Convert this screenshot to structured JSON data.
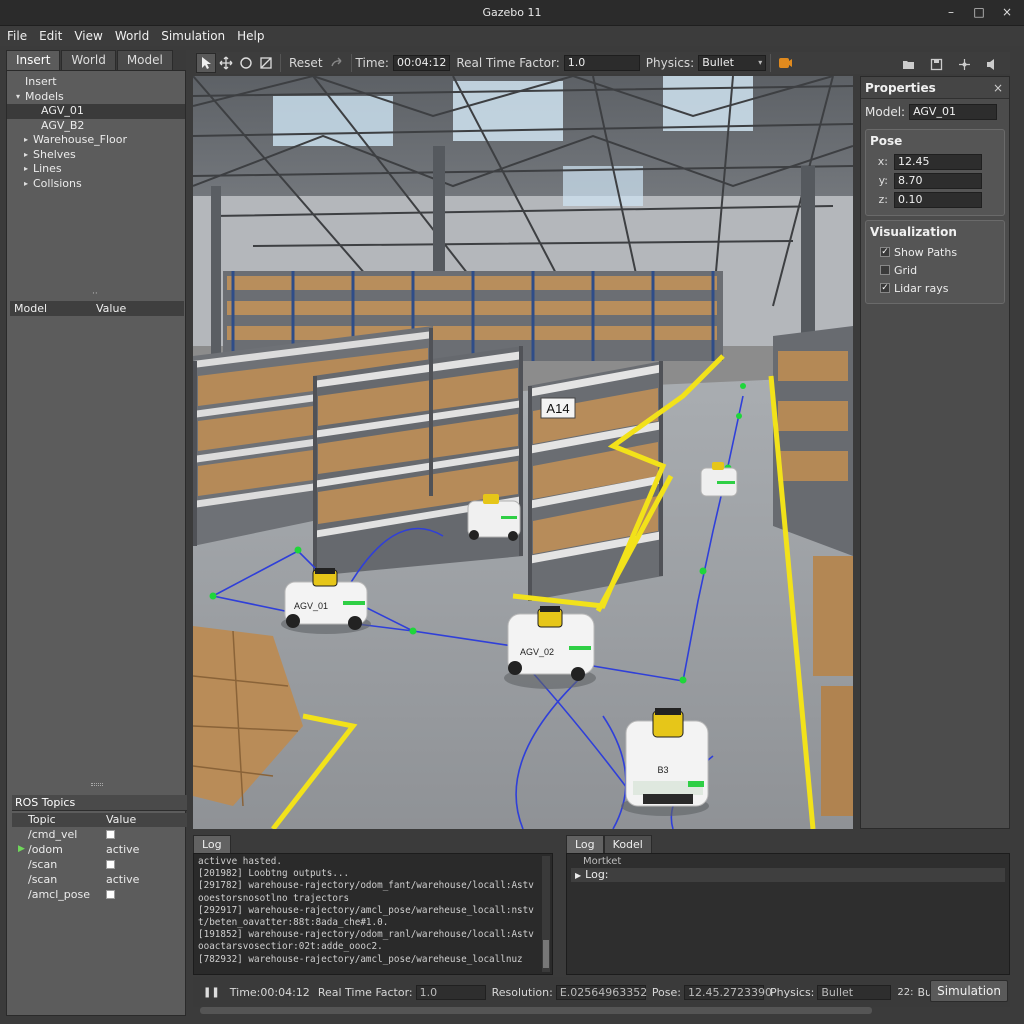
{
  "window": {
    "title": "Gazebo 11",
    "controls": [
      "–",
      "□",
      "×"
    ]
  },
  "menubar": [
    "File",
    "Edit",
    "View",
    "World",
    "Simulation",
    "Help"
  ],
  "left_panel": {
    "tabs": [
      "Insert",
      "World",
      "Model"
    ],
    "tree": [
      {
        "label": "Insert",
        "indent": 0,
        "arrow": ""
      },
      {
        "label": "Models",
        "indent": 0,
        "arrow": "▾"
      },
      {
        "label": "AGV_01",
        "indent": 2,
        "arrow": "",
        "selected": true
      },
      {
        "label": "AGV_B2",
        "indent": 2,
        "arrow": ""
      },
      {
        "label": "Warehouse_Floor",
        "indent": 1,
        "arrow": "▸"
      },
      {
        "label": "Shelves",
        "indent": 1,
        "arrow": "▸"
      },
      {
        "label": "Lines",
        "indent": 1,
        "arrow": "▸"
      },
      {
        "label": "Collsions",
        "indent": 1,
        "arrow": "▸"
      }
    ],
    "property_columns": [
      "Model",
      "Value"
    ],
    "ros_topics": {
      "title": "ROS Topics",
      "columns": [
        "Topic",
        "Value"
      ],
      "rows": [
        {
          "topic": "/cmd_vel",
          "value": "",
          "checkbox": true,
          "marked": false
        },
        {
          "topic": "/odom",
          "value": "active",
          "checkbox": false,
          "marked": true
        },
        {
          "topic": "/scan",
          "value": "",
          "checkbox": true,
          "marked": false
        },
        {
          "topic": "/scan",
          "value": "active",
          "checkbox": false,
          "marked": false
        },
        {
          "topic": "/amcl_pose",
          "value": "",
          "checkbox": true,
          "marked": false
        }
      ]
    }
  },
  "toolbar": {
    "reset_label": "Reset",
    "time_label": "Time:",
    "time_value": "00:04:12",
    "rtf_label": "Real Time Factor:",
    "rtf_value": "1.0",
    "physics_label": "Physics:",
    "physics_value": "Bullet"
  },
  "scene": {
    "shelf_label": "A14",
    "agv_labels": [
      "AGV_01",
      "AGV_02",
      "B3"
    ]
  },
  "properties": {
    "title": "Properties",
    "model_label": "Model:",
    "model_value": "AGV_01",
    "pose_title": "Pose",
    "pose": {
      "x": "12.45",
      "y": "8.70",
      "z": "0.10"
    },
    "visualization_title": "Visualization",
    "visualization": [
      {
        "label": "Show Paths",
        "checked": true
      },
      {
        "label": "Grid",
        "checked": false
      },
      {
        "label": "Lidar rays",
        "checked": true
      }
    ]
  },
  "log_left": {
    "tab": "Log",
    "lines": [
      "activve hasted.",
      "[201982] Loobtng outputs...",
      "[291782] warehouse-rajectory/odom_fant/warehouse/locall:Astv",
      "ooestorsnosotlno trajectors",
      "[292917] warehouse-rajectory/amcl_pose/wareheuse_locall:nstv",
      "t/beten_oavatter:88t:8ada_che#1.0.",
      "[191852] warehouse-rajectory/odom_ranl/warehouse/locall:Astv",
      "ooactarsvosectior:02t:adde_oooc2.",
      "[782932] warehouse-rajectory/amcl_pose/wareheuse_locallnuz"
    ]
  },
  "log_right": {
    "tabs": [
      "Log",
      "Kodel"
    ],
    "header": "Mortket",
    "row": "Log:"
  },
  "status_bar": {
    "pause_icon": "❚❚",
    "time_label": "Time:",
    "time_value": "00:04:12",
    "rtf_label": "Real Time Factor:",
    "rtf_value": "1.0",
    "resolution_label": "Resolution:",
    "resolution_value": "E.02564963352",
    "pose_label": "Pose:",
    "pose_value": "12.45.2723390",
    "physics_label": "Physics:",
    "physics_value": "Bullet",
    "extra_label": "22:",
    "extra_value": "Bullet",
    "simulation_button": "Simulation"
  },
  "colors": {
    "lane": "#f2e21a",
    "path": "#2f3fd9",
    "waypoint": "#1fd63a"
  }
}
